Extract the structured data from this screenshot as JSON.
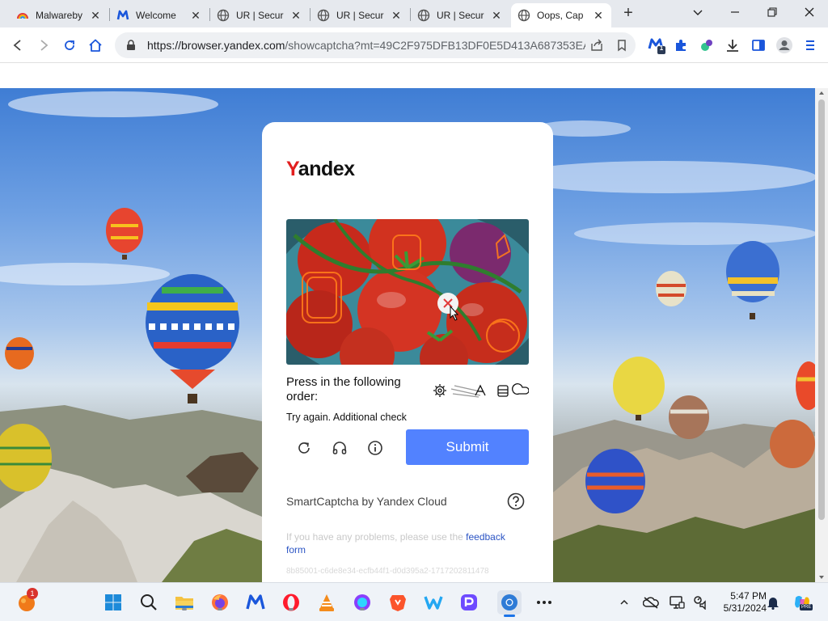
{
  "browser": {
    "tabs": [
      {
        "title": "Malwareby",
        "favicon": "malwarebytes-rainbow-icon",
        "active": false
      },
      {
        "title": "Welcome",
        "favicon": "malwarebytes-m-icon",
        "active": false
      },
      {
        "title": "UR | Secur",
        "favicon": "globe-icon",
        "active": false
      },
      {
        "title": "UR | Secur",
        "favicon": "globe-icon",
        "active": false
      },
      {
        "title": "UR | Secur",
        "favicon": "globe-icon",
        "active": false
      },
      {
        "title": "Oops, Cap",
        "favicon": "globe-icon",
        "active": true
      }
    ],
    "url_domain": "https://browser.yandex.com",
    "url_rest": "/showcaptcha?mt=49C2F975DFB13DF0E5D413A687353EA...",
    "extension_badge": "1"
  },
  "captcha": {
    "logo_first": "Y",
    "logo_rest": "andex",
    "instruction": "Press in the following order:",
    "error": "Try again. Additional check",
    "submit_label": "Submit",
    "brand": "SmartCaptcha by Yandex Cloud",
    "problems_text": "If you have any problems, please use the ",
    "problems_link": "feedback form",
    "request_id": "8b85001-c6de8e34-ecfb44f1-d0d395a2-1717202811478"
  },
  "taskbar": {
    "notification_badge": "1",
    "time": "5:47 PM",
    "date": "5/31/2024",
    "copilot_badge": "PRE"
  },
  "colors": {
    "submit": "#5282ff",
    "yandex_red": "#e21e1e",
    "link": "#2b54c4"
  }
}
